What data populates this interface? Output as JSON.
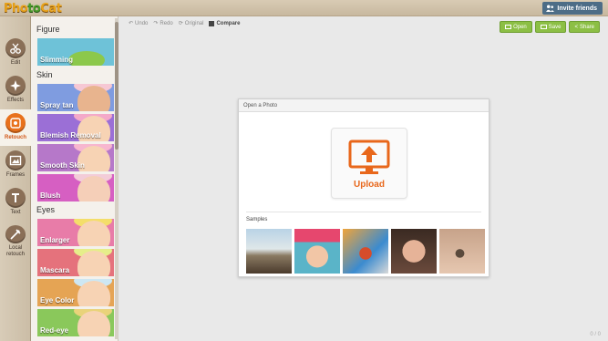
{
  "app": {
    "logo_part1": "Pho",
    "logo_part2": "to",
    "logo_part3": "Cat"
  },
  "header": {
    "invite_label": "Invite friends"
  },
  "rail": {
    "items": [
      {
        "label": "Edit",
        "icon": "scissors-icon"
      },
      {
        "label": "Effects",
        "icon": "effects-icon"
      },
      {
        "label": "Retouch",
        "icon": "retouch-icon",
        "active": true
      },
      {
        "label": "Frames",
        "icon": "frame-icon"
      },
      {
        "label": "Text",
        "icon": "text-icon"
      },
      {
        "label": "Local\nretouch",
        "icon": "local-retouch-icon"
      }
    ]
  },
  "panel": {
    "sections": [
      {
        "title": "Figure",
        "tiles": [
          "Slimming"
        ]
      },
      {
        "title": "Skin",
        "tiles": [
          "Spray tan",
          "Blemish Removal",
          "Smooth Skin",
          "Blush"
        ]
      },
      {
        "title": "Eyes",
        "tiles": [
          "Enlarger",
          "Mascara",
          "Eye Color",
          "Red-eye"
        ]
      }
    ]
  },
  "toolbar": {
    "undo": "Undo",
    "redo": "Redo",
    "original": "Original",
    "compare": "Compare"
  },
  "actions": {
    "open": "Open",
    "save": "Save",
    "share": "Share"
  },
  "dialog": {
    "title": "Open a Photo",
    "upload_label": "Upload",
    "samples_title": "Samples"
  },
  "footer": {
    "page_count": "0 / 0"
  },
  "colors": {
    "accent": "#e8671b",
    "green": "#8cbf45",
    "brown": "#8a6f57"
  }
}
